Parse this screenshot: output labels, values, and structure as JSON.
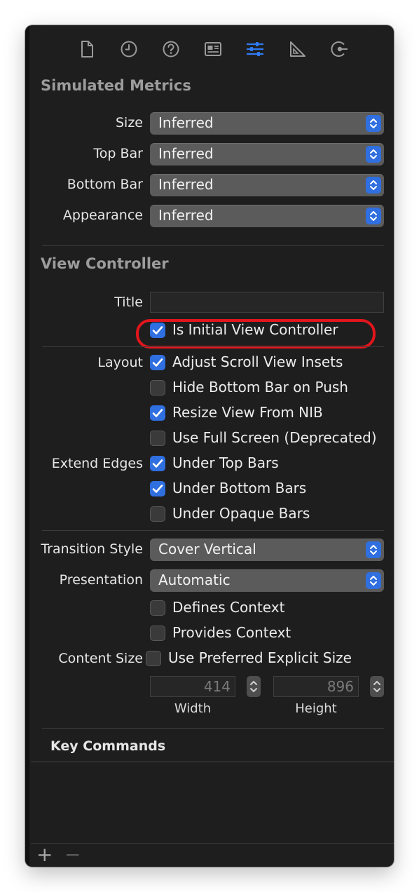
{
  "colors": {
    "accent": "#2f6fe0",
    "highlight": "#e1151c"
  },
  "toolbar": {
    "icons": [
      "file-icon",
      "history-icon",
      "help-icon",
      "identity-icon",
      "attributes-icon",
      "size-ruler-icon",
      "connections-icon"
    ],
    "active": "attributes-icon"
  },
  "simulated_metrics": {
    "title": "Simulated Metrics",
    "size": {
      "label": "Size",
      "value": "Inferred"
    },
    "top_bar": {
      "label": "Top Bar",
      "value": "Inferred"
    },
    "bottom_bar": {
      "label": "Bottom Bar",
      "value": "Inferred"
    },
    "appearance": {
      "label": "Appearance",
      "value": "Inferred"
    }
  },
  "view_controller": {
    "title": "View Controller",
    "title_field_label": "Title",
    "title_field_value": "",
    "is_initial": {
      "label": "Is Initial View Controller",
      "checked": true
    },
    "layout_label": "Layout",
    "layout": [
      {
        "label": "Adjust Scroll View Insets",
        "checked": true
      },
      {
        "label": "Hide Bottom Bar on Push",
        "checked": false
      },
      {
        "label": "Resize View From NIB",
        "checked": true
      },
      {
        "label": "Use Full Screen (Deprecated)",
        "checked": false
      }
    ],
    "extend_edges_label": "Extend Edges",
    "extend_edges": [
      {
        "label": "Under Top Bars",
        "checked": true
      },
      {
        "label": "Under Bottom Bars",
        "checked": true
      },
      {
        "label": "Under Opaque Bars",
        "checked": false
      }
    ],
    "transition_style": {
      "label": "Transition Style",
      "value": "Cover Vertical"
    },
    "presentation": {
      "label": "Presentation",
      "value": "Automatic"
    },
    "context": [
      {
        "label": "Defines Context",
        "checked": false
      },
      {
        "label": "Provides Context",
        "checked": false
      }
    ],
    "content_size": {
      "label": "Content Size",
      "checkbox_label": "Use Preferred Explicit Size",
      "checked": false,
      "width": {
        "value": "414",
        "label": "Width"
      },
      "height": {
        "value": "896",
        "label": "Height"
      }
    }
  },
  "key_commands": {
    "title": "Key Commands"
  },
  "bottom": {
    "add_label": "+",
    "remove_label": "−"
  }
}
